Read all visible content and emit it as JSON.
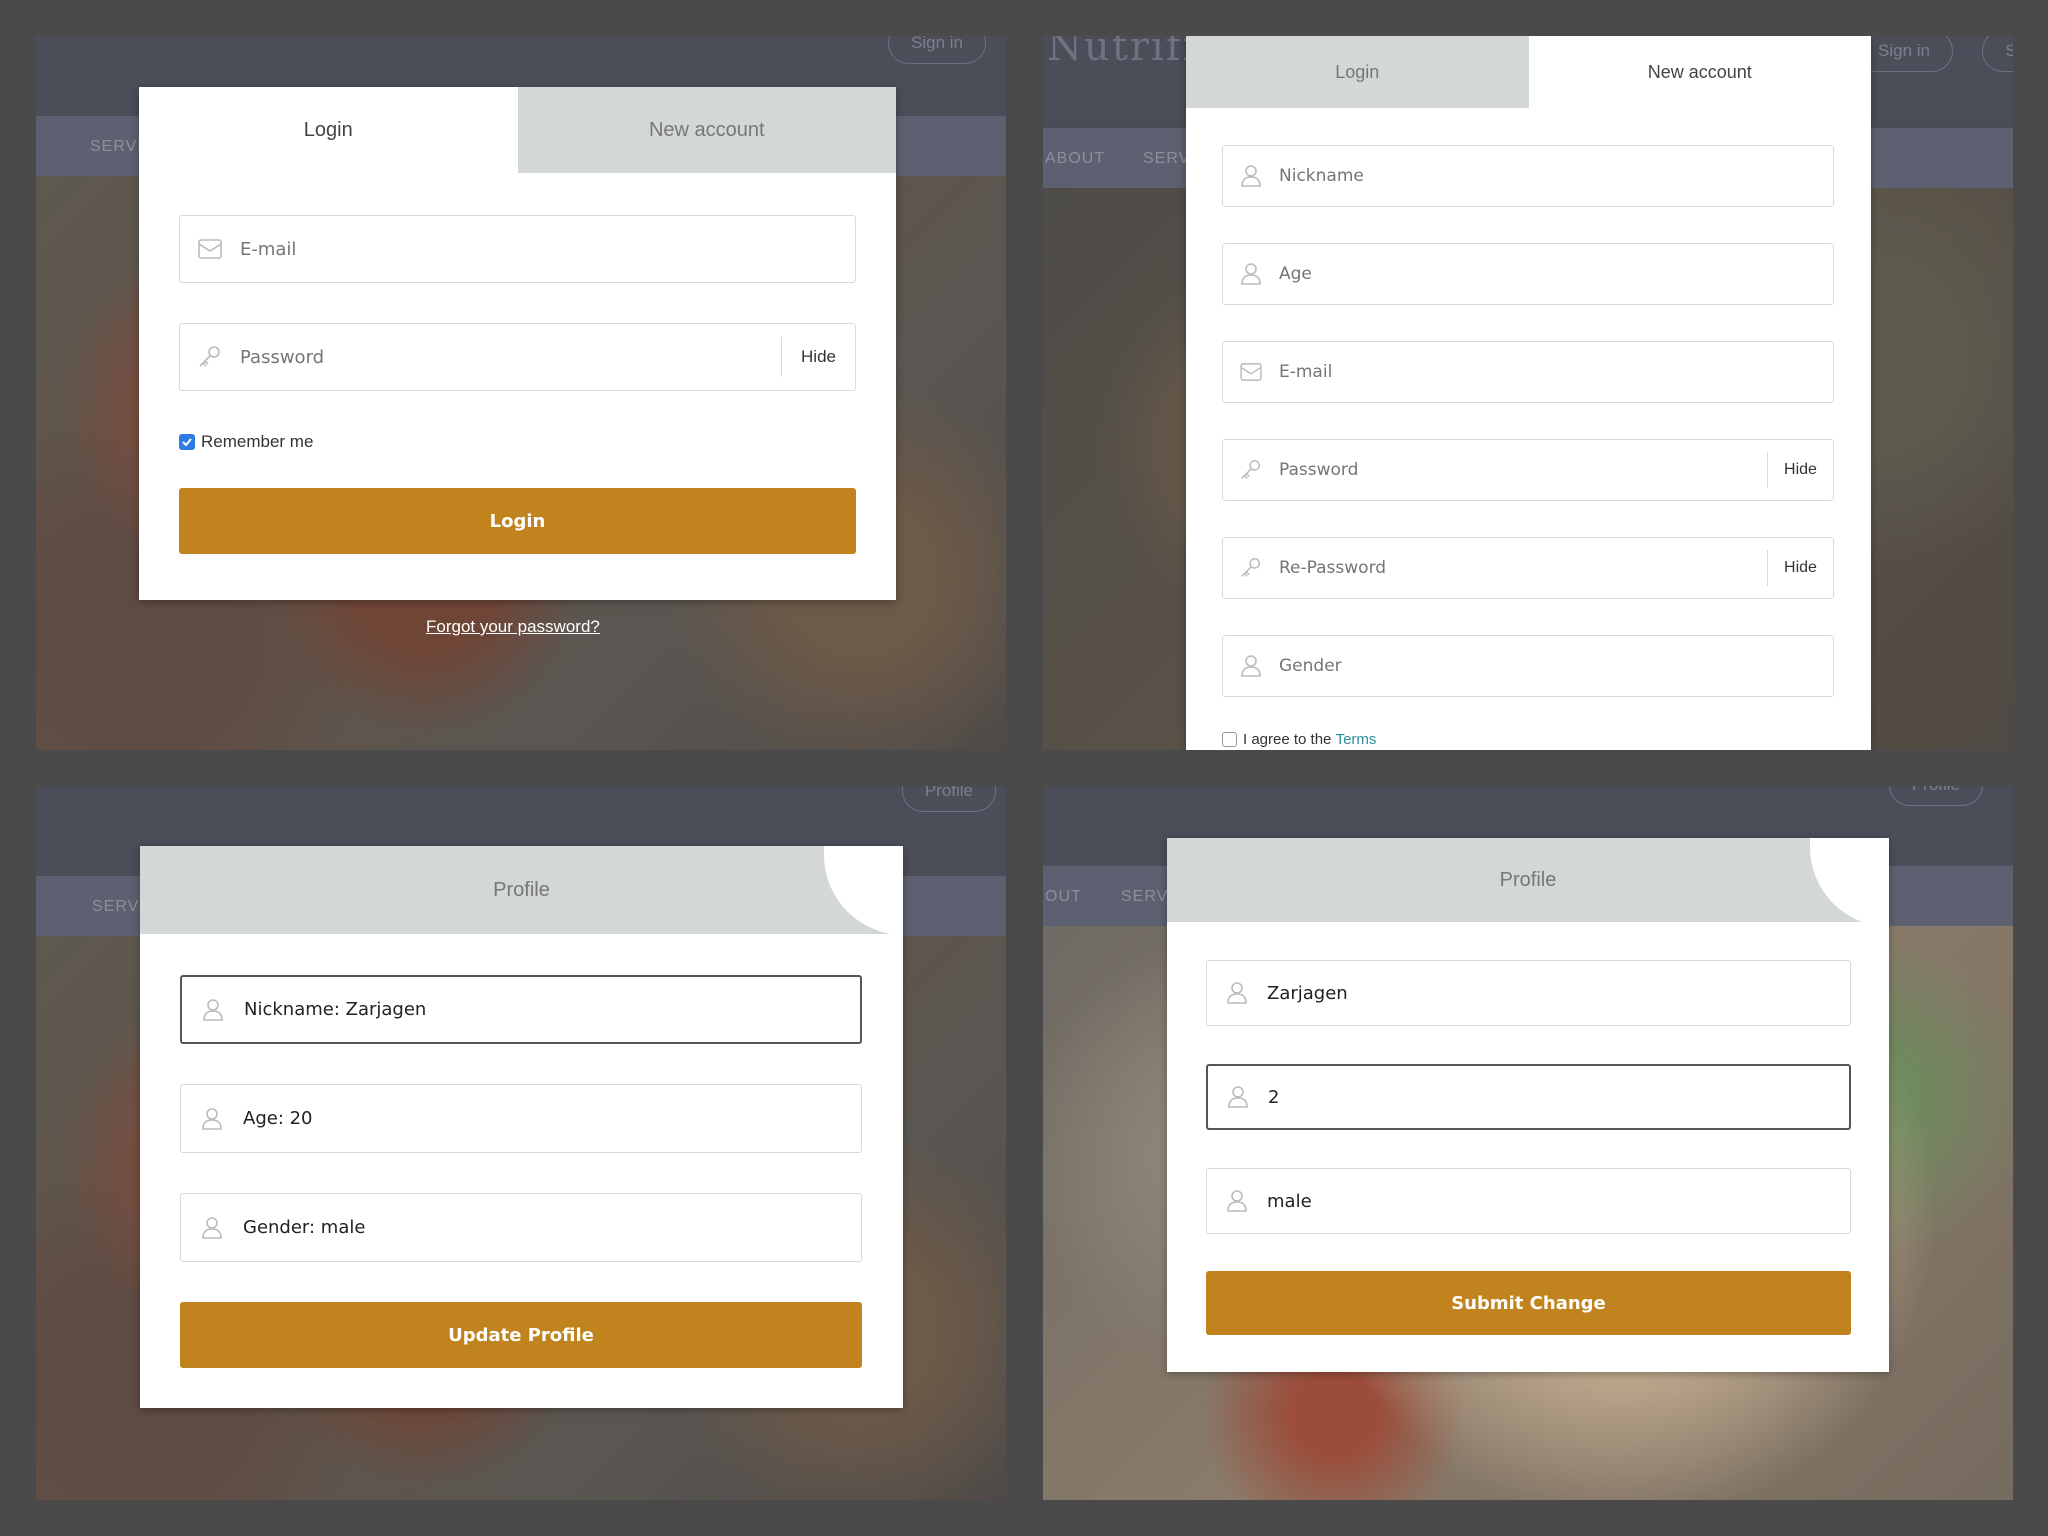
{
  "panel1": {
    "site": {
      "nav_text": "SERVI",
      "pill": "Sign in"
    },
    "tabs": {
      "login": "Login",
      "new_account": "New account"
    },
    "email_placeholder": "E-mail",
    "password_placeholder": "Password",
    "hide_label": "Hide",
    "remember_label": "Remember me",
    "login_button": "Login",
    "forgot_link": "Forgot your password?"
  },
  "panel2": {
    "site": {
      "logo": "Nutrifi",
      "nav_about": "ABOUT",
      "nav_serv": "SERVI",
      "pill1": "Sign in",
      "pill2": "Sig"
    },
    "tabs": {
      "login": "Login",
      "new_account": "New account"
    },
    "nickname_placeholder": "Nickname",
    "age_placeholder": "Age",
    "email_placeholder": "E-mail",
    "password_placeholder": "Password",
    "repassword_placeholder": "Re-Password",
    "gender_placeholder": "Gender",
    "hide_label": "Hide",
    "agree_text": "I agree to the",
    "terms_link": "Terms"
  },
  "panel3": {
    "site": {
      "nav_text": "SERVI",
      "pill": "Profile"
    },
    "header": "Profile",
    "nickname_value": "Nickname: Zarjagen",
    "age_value": "Age: 20",
    "gender_value": "Gender: male",
    "update_button": "Update Profile"
  },
  "panel4": {
    "site": {
      "nav_about": "OUT",
      "nav_serv": "SERVI",
      "pill": "Profile"
    },
    "header": "Profile",
    "nickname_value": "Zarjagen",
    "age_value": "2",
    "gender_value": "male",
    "submit_button": "Submit Change"
  },
  "colors": {
    "accent": "#c1831e",
    "tab_inactive": "#d3d8d7",
    "checkbox": "#2f7be5",
    "link": "#2a8fa0"
  },
  "icons": {
    "user": "user-icon",
    "mail": "mail-icon",
    "key": "key-icon"
  }
}
